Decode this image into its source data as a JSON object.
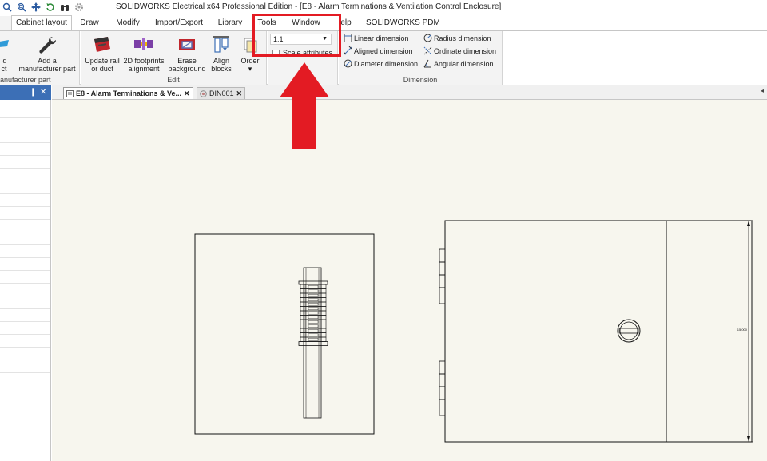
{
  "window": {
    "title": "SOLIDWORKS Electrical x64 Professional Edition - [E8 - Alarm Terminations & Ventilation Control Enclosure]"
  },
  "quick_access": [
    "search-icon",
    "zoom-window-icon",
    "pan-icon",
    "refresh-icon",
    "binoculars-icon",
    "settings-icon"
  ],
  "tabs": [
    {
      "label": "Cabinet layout",
      "active": true
    },
    {
      "label": "Draw"
    },
    {
      "label": "Modify"
    },
    {
      "label": "Import/Export"
    },
    {
      "label": "Library"
    },
    {
      "label": "Tools"
    },
    {
      "label": "Window"
    },
    {
      "label": "Help",
      "partial": "elp"
    },
    {
      "label": "SOLIDWORKS PDM"
    }
  ],
  "ribbon": {
    "left_partial": {
      "line1": "ld",
      "line2": "ct",
      "group": "anufacturer part"
    },
    "add_manufacturer": {
      "line1": "Add a",
      "line2": "manufacturer part"
    },
    "edit": {
      "group": "Edit",
      "update_rail": {
        "line1": "Update rail",
        "line2": "or duct"
      },
      "footprints": {
        "line1": "2D footprints",
        "line2": "alignment"
      },
      "erase": {
        "line1": "Erase",
        "line2": "background"
      },
      "align": {
        "line1": "Align",
        "line2": "blocks"
      },
      "order": {
        "line1": "Order",
        "line2": "▾"
      }
    },
    "scale": {
      "value": "1:1",
      "checkbox_label": "Scale attributes",
      "checked": false
    },
    "dimension": {
      "group": "Dimension",
      "linear": "Linear dimension",
      "aligned": "Aligned dimension",
      "diameter": "Diameter dimension",
      "radius": "Radius dimension",
      "ordinate": "Ordinate dimension",
      "angular": "Angular dimension"
    }
  },
  "left_panel": {
    "pin": "❙",
    "close": "✕"
  },
  "doc_tabs": [
    {
      "label": "E8 - Alarm Terminations & Ve...",
      "close": "✕",
      "active": true
    },
    {
      "label": "DIN001",
      "close": "✕",
      "active": false
    }
  ],
  "doc_tabs_scroll": "◂",
  "drawing": {
    "dimension_text": "15.000"
  },
  "colors": {
    "accent_blue": "#3c6fb6",
    "highlight_red": "#e31b23",
    "canvas_bg": "#f7f6ee"
  }
}
